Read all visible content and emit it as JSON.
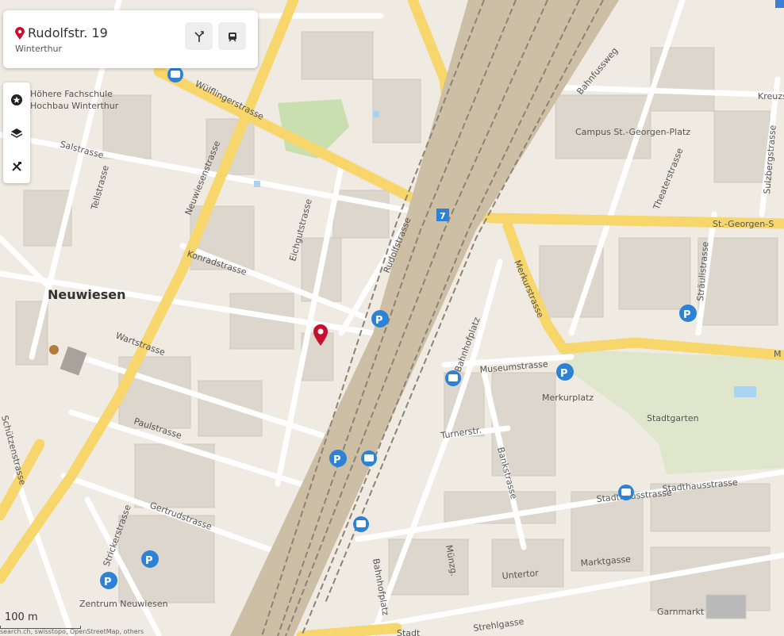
{
  "location": {
    "street": "Rudolfstr. 19",
    "city": "Winterthur"
  },
  "icons": {
    "pin": "map-pin-icon",
    "directions": "directions-fork-icon",
    "transit": "train-icon",
    "poi": "star-circle-icon",
    "layers": "layers-icon",
    "tools": "tools-icon"
  },
  "map": {
    "scale_label": "100 m",
    "attribution": "search.ch, swisstopo, OpenStreetMap, others",
    "district_label": "Neuwiesen",
    "platform_badge": "7",
    "streets": [
      "Höhere Fachschule",
      "Hochbau Winterthur",
      "Wülflingerstrasse",
      "Salstrasse",
      "Tellstrasse",
      "Neuwiesenstrasse",
      "Eichgutstrasse",
      "Konradstrasse",
      "Rudolfstrasse",
      "Wartstrasse",
      "Paulstrasse",
      "Gertrudstrasse",
      "Strickerstrasse",
      "Zentrum Neuwiesen",
      "Schützenstrasse",
      "Bahnfussweg",
      "Campus St.-Georgen-Platz",
      "Theaterstrasse",
      "St.-Georgen-S",
      "Sulzbergstrasse",
      "Kreuzs",
      "Merkurstrasse",
      "Bahnhofplatz",
      "Museumstrasse",
      "Merkurplatz",
      "Stadtgarten",
      "Turnerstr.",
      "Bankstrasse",
      "Stadthausstrasse",
      "Münzg.",
      "Untertor",
      "Marktgasse",
      "Garnmarkt",
      "Strehlgasse",
      "Stadt",
      "Stadthausstrasse",
      "Bahnhofplatz",
      "Sträulistrasse",
      "M"
    ]
  },
  "colors": {
    "main_road": "#f7d66b",
    "park": "#dfe6cc",
    "pin": "#c8102e",
    "parking": "#2d82d6"
  }
}
